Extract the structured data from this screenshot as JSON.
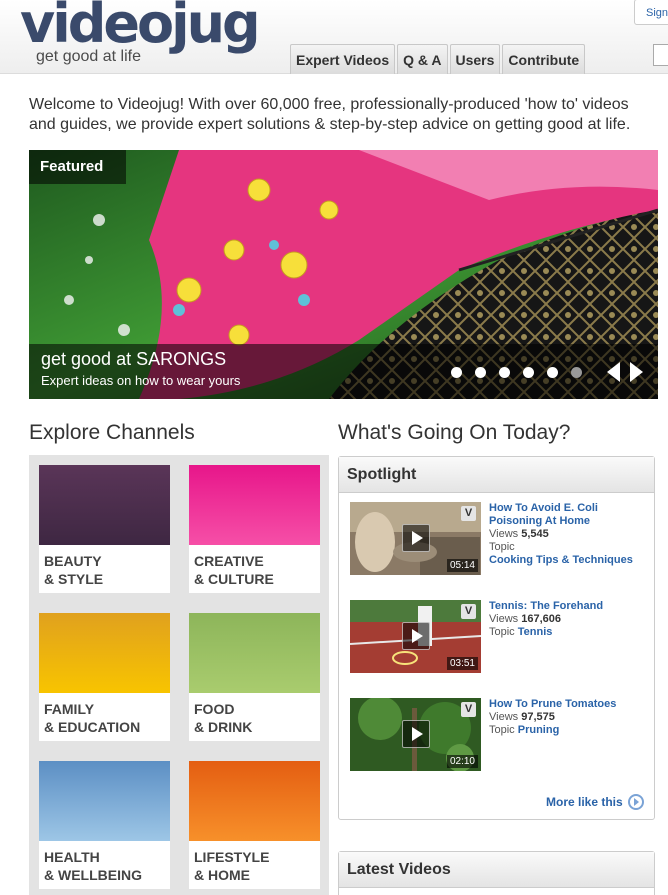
{
  "header": {
    "logo": "videojug",
    "tagline": "get good at life",
    "nav": [
      "Expert Videos",
      "Q & A",
      "Users",
      "Contribute"
    ],
    "signin": "Sign"
  },
  "welcome": "Welcome to Videojug! With over 60,000 free, professionally-produced 'how to' videos and guides, we provide expert solutions & step-by-step advice on getting good at life.",
  "featured": {
    "tag": "Featured",
    "title": "get good at SARONGS",
    "subtitle": "Expert ideas on how to wear yours",
    "slides": 6,
    "active_slide": 6
  },
  "explore": {
    "heading": "Explore Channels",
    "channels": [
      {
        "line1": "BEAUTY",
        "line2": "& STYLE",
        "color_top": "#5a3558",
        "color_bottom": "#3e2742"
      },
      {
        "line1": "CREATIVE",
        "line2": "& CULTURE",
        "color_top": "#e7168a",
        "color_bottom": "#f64fa7"
      },
      {
        "line1": "FAMILY",
        "line2": "& EDUCATION",
        "color_top": "#e0a11e",
        "color_bottom": "#f8c400"
      },
      {
        "line1": "FOOD",
        "line2": "& DRINK",
        "color_top": "#8db55a",
        "color_bottom": "#a9cc6e"
      },
      {
        "line1": "HEALTH",
        "line2": "& WELLBEING",
        "color_top": "#5c8fc4",
        "color_bottom": "#9dc6e6"
      },
      {
        "line1": "LIFESTYLE",
        "line2": "& HOME",
        "color_top": "#e45e12",
        "color_bottom": "#f7902a"
      }
    ]
  },
  "today": {
    "heading": "What's Going On Today?",
    "spotlight": {
      "title": "Spotlight",
      "videos": [
        {
          "title": "How To Avoid E. Coli Poisoning At Home",
          "views_label": "Views",
          "views": "5,545",
          "topic_label": "Topic",
          "topic": "Cooking Tips & Techniques",
          "duration": "05:14",
          "badge": "V"
        },
        {
          "title": "Tennis: The Forehand",
          "views_label": "Views",
          "views": "167,606",
          "topic_label": "Topic",
          "topic": "Tennis",
          "duration": "03:51",
          "badge": "V"
        },
        {
          "title": "How To Prune Tomatoes",
          "views_label": "Views",
          "views": "97,575",
          "topic_label": "Topic",
          "topic": "Pruning",
          "duration": "02:10",
          "badge": "V"
        }
      ],
      "more": "More like this"
    },
    "latest": {
      "title": "Latest Videos"
    }
  }
}
